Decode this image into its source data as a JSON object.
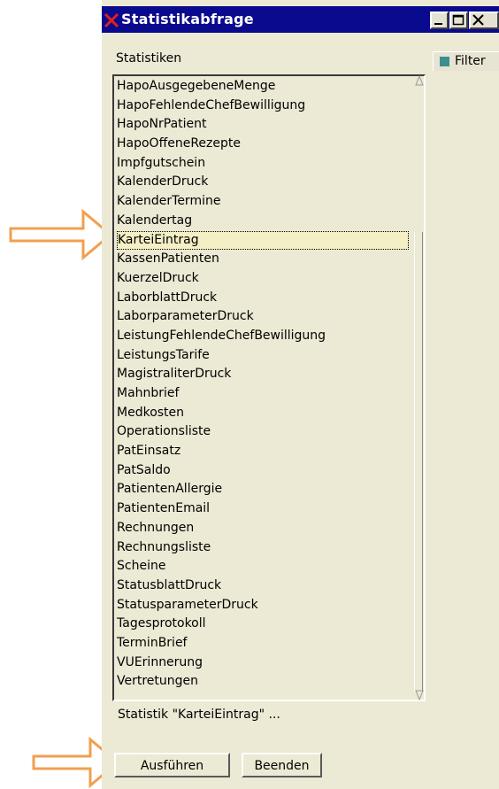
{
  "window": {
    "title": "Statistikabfrage",
    "title_buttons": [
      "minimize",
      "maximize",
      "close"
    ]
  },
  "labels": {
    "statistiken": "Statistiken",
    "filter": "Filter"
  },
  "list": {
    "items": [
      "HapoAusgegebeneMenge",
      "HapoFehlendeChefBewilligung",
      "HapoNrPatient",
      "HapoOffeneRezepte",
      "Impfgutschein",
      "KalenderDruck",
      "KalenderTermine",
      "Kalendertag",
      "KarteiEintrag",
      "KassenPatienten",
      "KuerzelDruck",
      "LaborblattDruck",
      "LaborparameterDruck",
      "LeistungFehlendeChefBewilligung",
      "LeistungsTarife",
      "MagistraliterDruck",
      "Mahnbrief",
      "Medkosten",
      "Operationsliste",
      "PatEinsatz",
      "PatSaldo",
      "PatientenAllergie",
      "PatientenEmail",
      "Rechnungen",
      "Rechnungsliste",
      "Scheine",
      "StatusblattDruck",
      "StatusparameterDruck",
      "Tagesprotokoll",
      "TerminBrief",
      "VUErinnerung",
      "Vertretungen"
    ],
    "selected": "KarteiEintrag"
  },
  "status": "Statistik \"KarteiEintrag\" ...",
  "buttons": {
    "run": "Ausführen",
    "quit": "Beenden"
  },
  "colors": {
    "titlebar": "#0a0a8e",
    "window_bg": "#ece9d4",
    "annotation_arrow": "#f0a050",
    "filter_indicator": "#3d8e8e"
  }
}
